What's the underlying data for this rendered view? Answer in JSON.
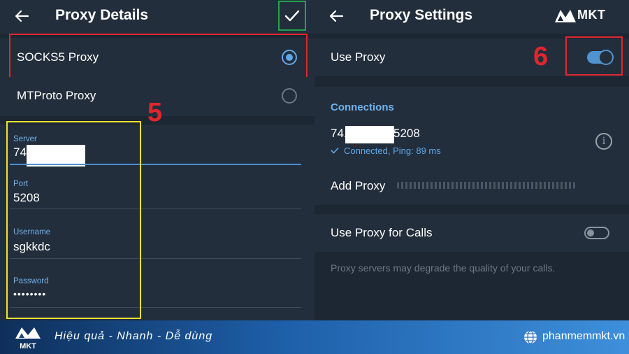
{
  "left_screen": {
    "title": "Proxy Details",
    "proxy_types": [
      {
        "label": "SOCKS5 Proxy",
        "selected": true
      },
      {
        "label": "MTProto Proxy",
        "selected": false
      }
    ],
    "fields": {
      "server": {
        "label": "Server",
        "value": "74."
      },
      "port": {
        "label": "Port",
        "value": "5208"
      },
      "username": {
        "label": "Username",
        "value": "sgkkdc"
      },
      "password": {
        "label": "Password",
        "value": "••••••••"
      }
    },
    "step_label": "5"
  },
  "right_screen": {
    "title": "Proxy Settings",
    "use_proxy": {
      "label": "Use Proxy",
      "enabled": true
    },
    "step_label": "6",
    "connections": {
      "heading": "Connections",
      "address_start": "74.",
      "address_end": "5208",
      "status": "Connected, Ping: 89 ms"
    },
    "add_proxy_label": "Add Proxy",
    "use_proxy_for_calls": {
      "label": "Use Proxy for Calls",
      "enabled": false
    },
    "calls_hint": "Proxy servers may degrade the quality of your calls."
  },
  "brand": {
    "logo_text": "MKT",
    "slogan": "Hiệu quả - Nhanh  - Dễ dùng",
    "website": "phanmemmkt.vn"
  },
  "colors": {
    "background": "#1d2733",
    "accent": "#5fa8e8",
    "highlight_red": "#e0262d",
    "highlight_yellow": "#f2e130",
    "highlight_green": "#21a44b"
  }
}
